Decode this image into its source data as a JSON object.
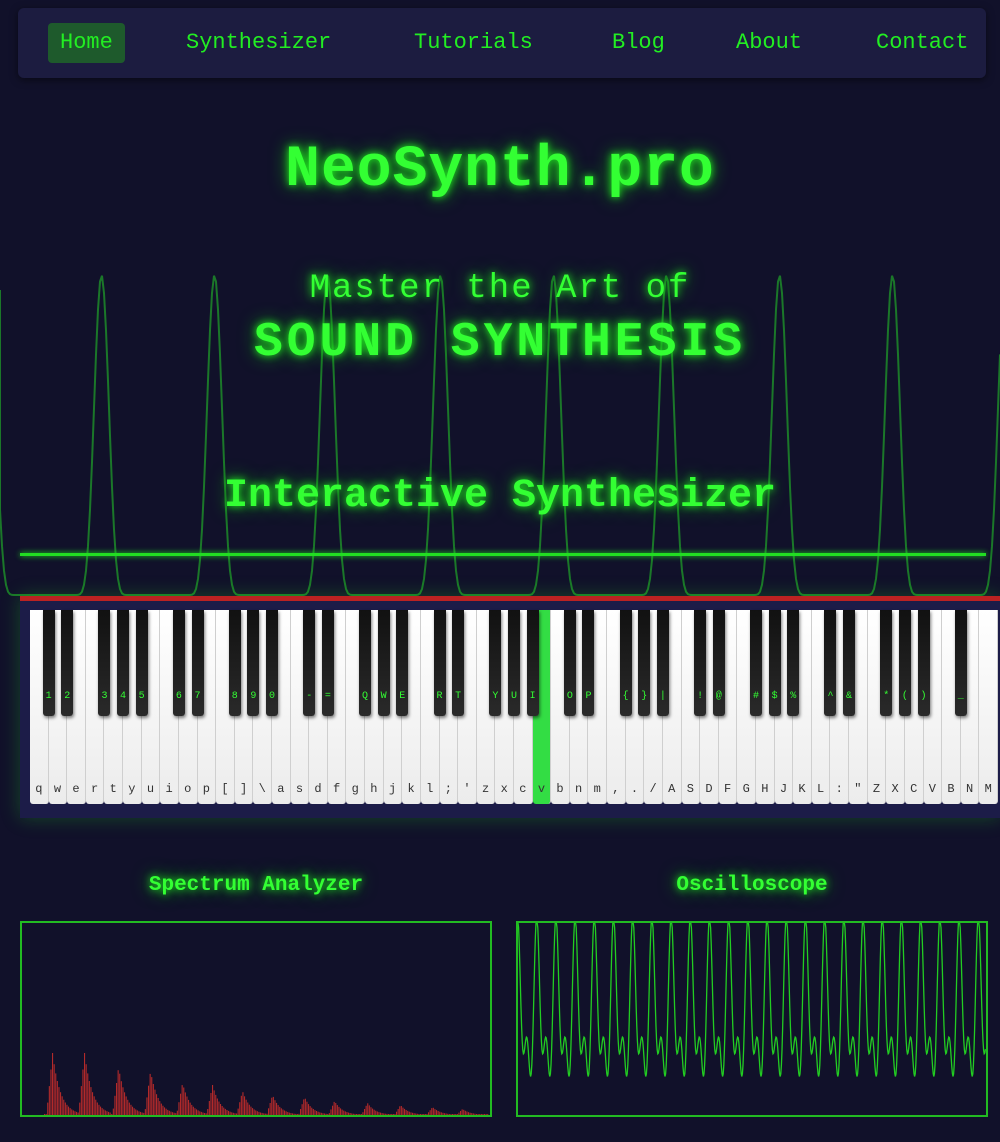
{
  "nav": {
    "items": [
      {
        "label": "Home",
        "active": true
      },
      {
        "label": "Synthesizer",
        "active": false
      },
      {
        "label": "Tutorials",
        "active": false
      },
      {
        "label": "Blog",
        "active": false
      },
      {
        "label": "About",
        "active": false
      },
      {
        "label": "Contact",
        "active": false
      }
    ]
  },
  "site_title": "NeoSynth.pro",
  "hero": {
    "subtitle": "Master the Art of",
    "headline": "SOUND SYNTHESIS"
  },
  "section_title": "Interactive Synthesizer",
  "keyboard": {
    "white_labels": [
      "q",
      "w",
      "e",
      "r",
      "t",
      "y",
      "u",
      "i",
      "o",
      "p",
      "[",
      "]",
      "\\",
      "a",
      "s",
      "d",
      "f",
      "g",
      "h",
      "j",
      "k",
      "l",
      ";",
      "'",
      "z",
      "x",
      "c",
      "v",
      "b",
      "n",
      "m",
      ",",
      ".",
      "/",
      "A",
      "S",
      "D",
      "F",
      "G",
      "H",
      "J",
      "K",
      "L",
      ":",
      "\"",
      "Z",
      "X",
      "C",
      "V",
      "B",
      "N",
      "M"
    ],
    "black_labels": [
      "1",
      "2",
      "3",
      "4",
      "5",
      "6",
      "7",
      "8",
      "9",
      "0",
      "-",
      "=",
      "Q",
      "W",
      "E",
      "R",
      "T",
      "Y",
      "U",
      "I",
      "O",
      "P",
      "{",
      "}",
      "|",
      "!",
      "@",
      "#",
      "$",
      "%",
      "^",
      "&",
      "*",
      "(",
      ")",
      "_"
    ],
    "active_key": "v"
  },
  "spectrum": {
    "title": "Spectrum Analyzer"
  },
  "oscilloscope": {
    "title": "Oscilloscope"
  },
  "colors": {
    "accent": "#33ff33",
    "background": "#11112a",
    "spectrum_bars": "#b22a2a",
    "keyboard_border": "#bb2222"
  }
}
